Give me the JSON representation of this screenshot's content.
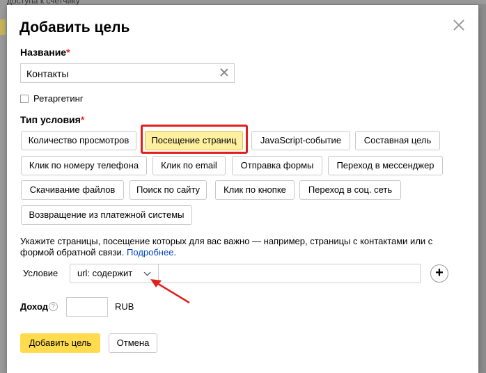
{
  "background": {
    "top_text": "доступа к счетчику"
  },
  "dialog": {
    "title": "Добавить цель",
    "name_label": "Название",
    "required_mark": "*",
    "name_value": "Контакты",
    "retargeting_label": "Ретаргетинг",
    "condition_type_label": "Тип условия",
    "condition_types": [
      "Количество просмотров",
      "Посещение страниц",
      "JavaScript-событие",
      "Составная цель",
      "Клик по номеру телефона",
      "Клик по email",
      "Отправка формы",
      "Переход в мессенджер",
      "Скачивание файлов",
      "Поиск по сайту",
      "Клик по кнопке",
      "Переход в соц. сеть",
      "Возвращение из платежной системы"
    ],
    "selected_condition_type": "Посещение страниц",
    "hint_text": "Укажите страницы, посещение которых для вас важно — например, страницы с контактами или с формой обратной связи. ",
    "hint_link": "Подробнее",
    "hint_end": ".",
    "condition_label": "Условие",
    "condition_select_value": "url: содержит",
    "condition_input_value": "",
    "add_condition_symbol": "+",
    "income_label": "Доход",
    "income_help_symbol": "?",
    "income_value": "",
    "currency": "RUB",
    "submit_label": "Добавить цель",
    "cancel_label": "Отмена"
  },
  "colors": {
    "accent_yellow": "#ffdb4d",
    "selected_bg": "#fff0a0",
    "highlight_red": "#e0201c",
    "link_blue": "#0044bb"
  }
}
